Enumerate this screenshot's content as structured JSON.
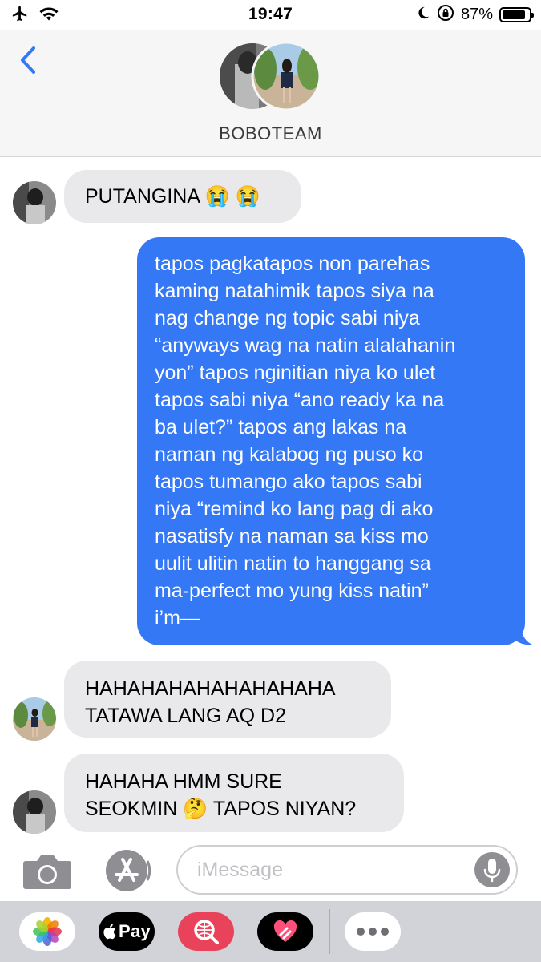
{
  "status_bar": {
    "time": "19:47",
    "battery_percent": "87%",
    "battery_level": 0.87,
    "icons": [
      "airplane-icon",
      "wifi-icon",
      "moon-icon",
      "orientation-lock-icon",
      "battery-icon"
    ]
  },
  "header": {
    "title": "BOBOTEAM",
    "back_icon": "chevron-left-icon"
  },
  "messages": [
    {
      "from": "incoming",
      "lines": [
        "PUTANGINA 😭 😭"
      ]
    },
    {
      "from": "outgoing",
      "lines": [
        "tapos pagkatapos non parehas",
        "kaming natahimik tapos siya na",
        "nag change ng topic sabi niya",
        "“anyways wag na natin alalahanin",
        "yon” tapos nginitian niya ko ulet",
        "tapos sabi niya “ano ready ka na",
        "ba ulet?” tapos ang lakas na",
        "naman ng kalabog ng puso ko",
        "tapos tumango ako tapos sabi",
        "niya “remind ko lang pag di ako",
        "nasatisfy na naman sa kiss mo",
        "uulit ulitin natin to hanggang sa",
        "ma-perfect mo yung kiss natin”",
        "i’m—"
      ]
    },
    {
      "from": "incoming",
      "lines": [
        "HAHAHAHAHAHAHAHAHA",
        "TATAWA LANG AQ D2"
      ]
    },
    {
      "from": "incoming",
      "lines": [
        "HAHAHA HMM SURE",
        "SEOKMIN 🤔  TAPOS NIYAN?"
      ]
    }
  ],
  "input_bar": {
    "placeholder": "iMessage",
    "icons": [
      "camera-icon",
      "app-store-icon",
      "microphone-icon"
    ]
  },
  "app_drawer": {
    "apple_pay_label": "Pay",
    "apps": [
      "photos-icon",
      "apple-pay-icon",
      "web-images-icon",
      "digital-touch-icon",
      "more-icon"
    ]
  },
  "colors": {
    "outgoing_bubble": "#3478f6",
    "incoming_bubble": "#e9e9eb",
    "accent": "#3478f6",
    "drawer_bg": "#d1d3d9"
  }
}
